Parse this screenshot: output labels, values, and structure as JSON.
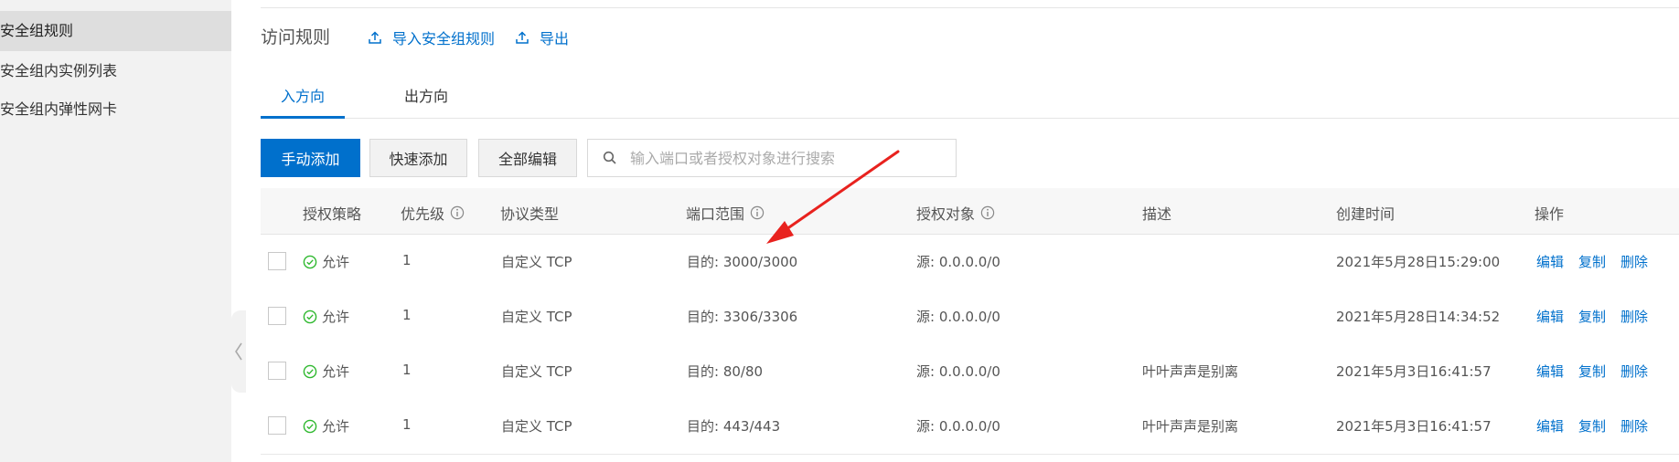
{
  "sidebar": {
    "items": [
      {
        "label": "安全组规则",
        "active": true
      },
      {
        "label": "安全组内实例列表",
        "active": false
      },
      {
        "label": "安全组内弹性网卡",
        "active": false
      }
    ]
  },
  "header": {
    "title": "访问规则",
    "import_label": "导入安全组规则",
    "export_label": "导出"
  },
  "tabs": [
    {
      "label": "入方向",
      "active": true
    },
    {
      "label": "出方向",
      "active": false
    }
  ],
  "toolbar": {
    "manual_add": "手动添加",
    "quick_add": "快速添加",
    "edit_all": "全部编辑",
    "search_placeholder": "输入端口或者授权对象进行搜索"
  },
  "table": {
    "columns": [
      "授权策略",
      "优先级",
      "协议类型",
      "端口范围",
      "授权对象",
      "描述",
      "创建时间",
      "操作"
    ],
    "rows": [
      {
        "policy": "允许",
        "priority": "1",
        "protocol": "自定义 TCP",
        "port": "目的: 3000/3000",
        "source": "源: 0.0.0.0/0",
        "desc": "",
        "created": "2021年5月28日15:29:00"
      },
      {
        "policy": "允许",
        "priority": "1",
        "protocol": "自定义 TCP",
        "port": "目的: 3306/3306",
        "source": "源: 0.0.0.0/0",
        "desc": "",
        "created": "2021年5月28日14:34:52"
      },
      {
        "policy": "允许",
        "priority": "1",
        "protocol": "自定义 TCP",
        "port": "目的: 80/80",
        "source": "源: 0.0.0.0/0",
        "desc": "叶叶声声是别离",
        "created": "2021年5月3日16:41:57"
      },
      {
        "policy": "允许",
        "priority": "1",
        "protocol": "自定义 TCP",
        "port": "目的: 443/443",
        "source": "源: 0.0.0.0/0",
        "desc": "叶叶声声是别离",
        "created": "2021年5月3日16:41:57"
      }
    ],
    "actions": {
      "edit": "编辑",
      "copy": "复制",
      "delete": "删除"
    }
  },
  "colors": {
    "accent": "#0070cc",
    "annotation": "#e8221e",
    "allow": "#2eb82e"
  }
}
